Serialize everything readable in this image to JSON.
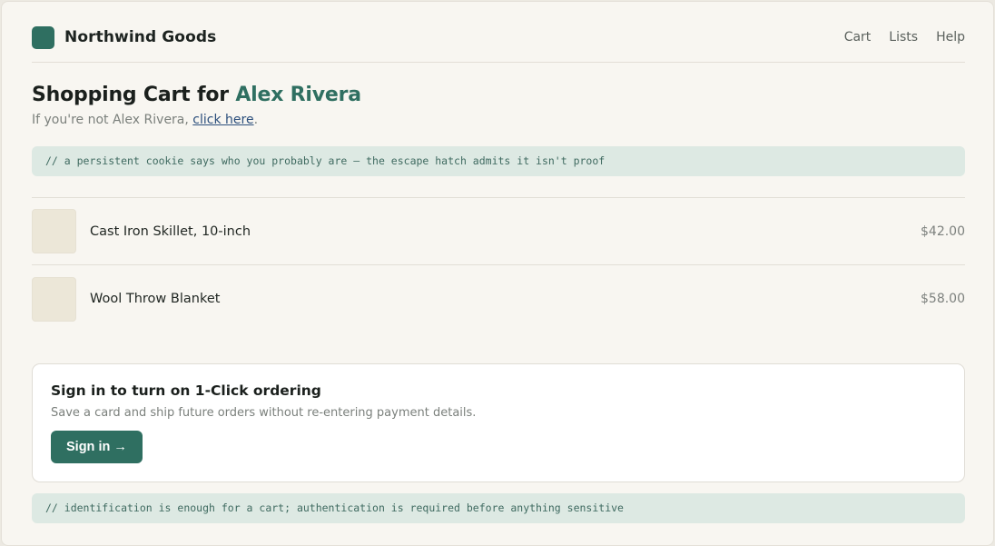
{
  "brand": {
    "name": "Northwind Goods",
    "logo_color": "#2f6f61"
  },
  "nav": [
    {
      "label": "Cart"
    },
    {
      "label": "Lists"
    },
    {
      "label": "Help"
    }
  ],
  "cart": {
    "heading_prefix": "Shopping Cart for ",
    "user_name": "Alex Rivera",
    "not_you_text": "If you're not Alex Rivera, ",
    "not_you_link": "click here",
    "not_you_suffix": "."
  },
  "notes": {
    "cookie_note": "// a persistent cookie says who you probably are — the escape hatch admits it isn't proof",
    "auth_note": "// identification is enough for a cart; authentication is required before anything sensitive"
  },
  "items": [
    {
      "name": "Cast Iron Skillet, 10-inch",
      "price": "$42.00"
    },
    {
      "name": "Wool Throw Blanket",
      "price": "$58.00"
    }
  ],
  "signin": {
    "title": "Sign in to turn on 1-Click ordering",
    "subtitle": "Save a card and ship future orders without re-entering payment details.",
    "button_label": "Sign in →"
  },
  "colors": {
    "accent": "#2f6f61",
    "note_bg": "#dde9e3",
    "page_bg": "#f8f6f1"
  }
}
